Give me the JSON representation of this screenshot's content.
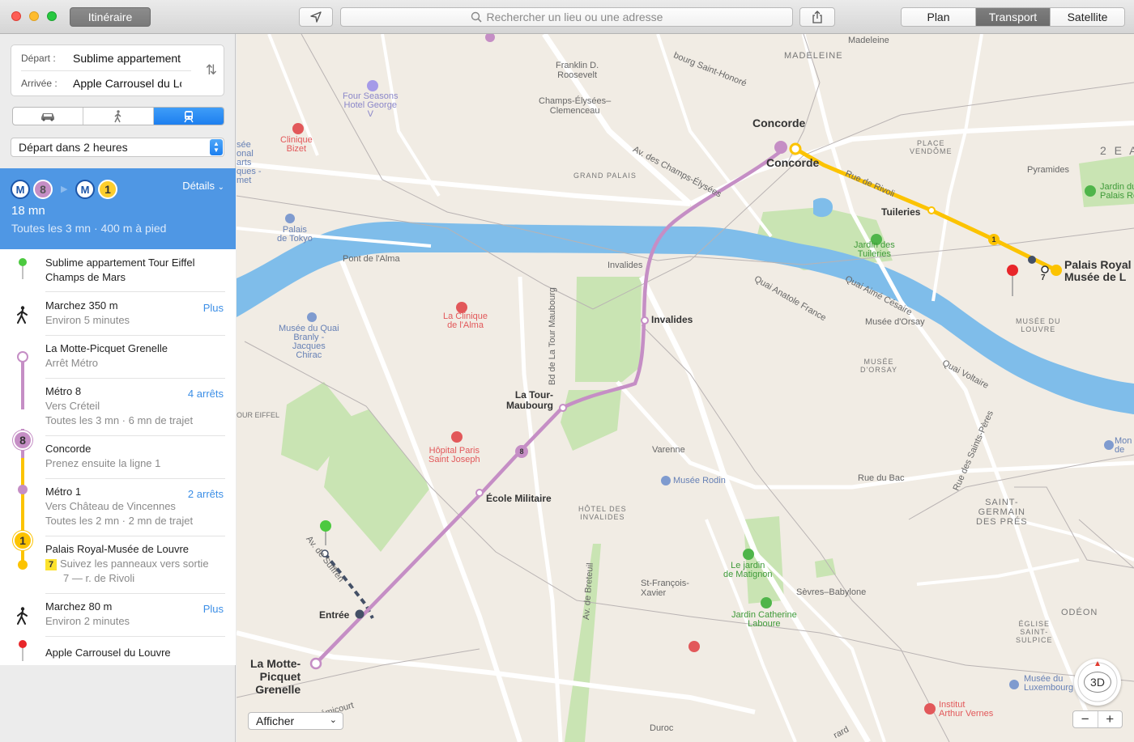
{
  "titlebar": {
    "itinerary_button": "Itinéraire",
    "search_placeholder": "Rechercher un lieu ou une adresse",
    "map_modes": [
      "Plan",
      "Transport",
      "Satellite"
    ],
    "active_map_mode": "Transport"
  },
  "route": {
    "from_label": "Départ :",
    "from_value": "Sublime appartement Tour Eiffel",
    "to_label": "Arrivée :",
    "to_value": "Apple Carrousel du Louvre",
    "depart_option": "Départ dans 2 heures",
    "active_mode": "transit"
  },
  "summary": {
    "metro_symbol": "M",
    "line1": "8",
    "line2": "1",
    "details_label": "Détails",
    "duration": "18 mn",
    "subtitle": "Toutes les 3 mn · 400 m à pied"
  },
  "steps": [
    {
      "title": "Sublime appartement Tour Eiffel",
      "sub": "Champs de Mars",
      "more": ""
    },
    {
      "title": "Marchez 350 m",
      "sub": "Environ 5 minutes",
      "more": "Plus"
    },
    {
      "title": "La Motte-Picquet Grenelle",
      "sub": "Arrêt Métro",
      "more": ""
    },
    {
      "title": "Métro 8",
      "sub": "Vers Créteil",
      "sub2": "Toutes les 3 mn · 6 mn de trajet",
      "more": "4 arrêts"
    },
    {
      "title": "Concorde",
      "sub": "Prenez ensuite la ligne 1",
      "more": ""
    },
    {
      "title": "Métro 1",
      "sub": "Vers Château de Vincennes",
      "sub2": "Toutes les 2 mn · 2 mn de trajet",
      "more": "2 arrêts"
    },
    {
      "title": "Palais Royal-Musée de Louvre",
      "exit_badge": "7",
      "sub": "Suivez les panneaux vers sortie",
      "sub2": "7 — r. de Rivoli",
      "more": ""
    },
    {
      "title": "Marchez 80 m",
      "sub": "Environ 2 minutes",
      "more": "Plus"
    },
    {
      "title": "Apple Carrousel du Louvre",
      "sub": "",
      "more": ""
    }
  ],
  "map": {
    "stations": {
      "concorde1": "Concorde",
      "concorde2": "Concorde",
      "tuileries": "Tuileries",
      "palais_royal": "Palais Royal\nMusée de L",
      "invalides": "Invalides",
      "tour_maubourg": "La Tour-\nMaubourg",
      "ecole": "École Militaire",
      "motte": "La Motte-\nPicquet\nGrenelle",
      "entree": "Entrée",
      "varenne": "Varenne",
      "invalides_small": "Invalides",
      "madeleine": "Madeleine",
      "franklin": "Franklin D.\nRoosevelt",
      "champs": "Champs-Élysées–\nClemenceau",
      "pont_alma": "Pont de l'Alma",
      "musee_orsay_stn": "Musée d'Orsay",
      "rue_bac": "Rue du Bac",
      "st_francois": "St-François-\nXavier",
      "sevres": "Sèvres–Babylone",
      "pyramides": "Pyramides",
      "duroc": "Duroc",
      "odeon": "ODÉON"
    },
    "places": {
      "four_seasons": "Four Seasons\nHotel George\nV",
      "clinique_bizet": "Clinique\nBizet",
      "palais_tokyo": "Palais\nde Tokyo",
      "quai_branly": "Musée du Quai\nBranly -\nJacques\nChirac",
      "clinique_alma": "La Clinique\nde l'Alma",
      "hopital": "Hôpital Paris\nSaint Joseph",
      "rodin": "Musée Rodin",
      "grand_palais": "GRAND PALAIS",
      "hotel_invalides": "HÔTEL DES\nINVALIDES",
      "place_vendome": "PLACE\nVENDÔME",
      "musee_louvre": "MUSÉE DU\nLOUVRE",
      "musee_orsay": "MUSÉE\nD'ORSAY",
      "eglise": "ÉGLISE\nSAINT-\nSULPICE",
      "jardin_tuileries": "Jardin des\nTuileries",
      "jardin_matignon": "Le jardin\nde Matignon",
      "jardin_catherine": "Jardin Catherine\nLaboure",
      "jardin_palais": "Jardin du\nPalais Ro",
      "musee_luxembourg": "Musée du\nLuxembourg",
      "institut": "Institut\nArthur Vernes",
      "mon": "Mon\nde",
      "tour_eiffel": "OUR EIFFEL",
      "see": "sée\nonal\narts\nques -\nmet"
    },
    "districts": {
      "madeleine": "MADELEINE",
      "arrond": "2 E A",
      "st_germain": "SAINT-\nGERMAIN\nDES PRÉS"
    },
    "streets": {
      "champs_elysees": "Av. des Champs-Élysées",
      "rivoli": "Rue de Rivoli",
      "faubourg": "bourg Saint-Honoré",
      "anatole": "Quai Anatole France",
      "aime": "Quai Aimé Césaire",
      "voltaire": "Quai Voltaire",
      "tour_maubourg_bd": "Bd de La Tour Maubourg",
      "breteuil": "Av. de Breteuil",
      "suffren": "Av. de Suffren",
      "saints_peres": "Rue des Saints-Pères",
      "fremicourt": "Frémicourt",
      "rard": "rard"
    },
    "line_badges": {
      "l8": "8",
      "l1": "1",
      "exit7": "7"
    },
    "show_menu": "Afficher",
    "three_d": "3D",
    "zoom_out": "−",
    "zoom_in": "+"
  },
  "colors": {
    "line8": "#c58ec5",
    "line1": "#fcc300",
    "water": "#7fbdea",
    "park": "#c9e4b3",
    "accent": "#3b8ee6"
  }
}
